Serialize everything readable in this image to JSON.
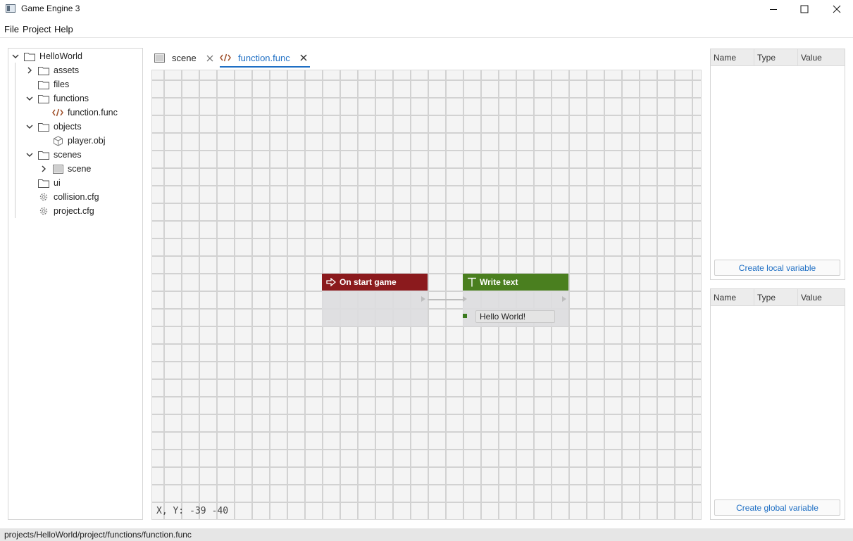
{
  "window": {
    "title": "Game Engine 3"
  },
  "menu": {
    "items": [
      "File",
      "Project",
      "Help"
    ]
  },
  "tree": {
    "items": [
      {
        "label": "HelloWorld",
        "type": "folder",
        "expanded": true
      },
      {
        "label": "assets",
        "type": "folder",
        "expanded": false
      },
      {
        "label": "files",
        "type": "folder"
      },
      {
        "label": "functions",
        "type": "folder",
        "expanded": true
      },
      {
        "label": "function.func",
        "type": "function-file"
      },
      {
        "label": "objects",
        "type": "folder",
        "expanded": true
      },
      {
        "label": "player.obj",
        "type": "object-file"
      },
      {
        "label": "scenes",
        "type": "folder",
        "expanded": true
      },
      {
        "label": "scene",
        "type": "scene-file",
        "expanded": false
      },
      {
        "label": "ui",
        "type": "folder"
      },
      {
        "label": "collision.cfg",
        "type": "config-file"
      },
      {
        "label": "project.cfg",
        "type": "config-file"
      }
    ]
  },
  "tabs": [
    {
      "label": "scene",
      "icon": "image-icon",
      "active": false
    },
    {
      "label": "function.func",
      "icon": "code-icon",
      "active": true
    }
  ],
  "canvas": {
    "coords_label": "X, Y:",
    "x": "-39",
    "y": "-40",
    "nodes": {
      "start": {
        "title": "On start game",
        "color": "#8b1a1d",
        "icon": "arrow-right-icon"
      },
      "write": {
        "title": "Write text",
        "color": "#4a7f1f",
        "icon": "text-icon",
        "input_value": "Hello World!"
      }
    }
  },
  "local_vars": {
    "columns": [
      "Name",
      "Type",
      "Value"
    ],
    "button": "Create local variable"
  },
  "global_vars": {
    "columns": [
      "Name",
      "Type",
      "Value"
    ],
    "button": "Create global variable"
  },
  "status": {
    "path": "projects/HelloWorld/project/functions/function.func"
  },
  "colors": {
    "accent": "#1f6fc4"
  }
}
